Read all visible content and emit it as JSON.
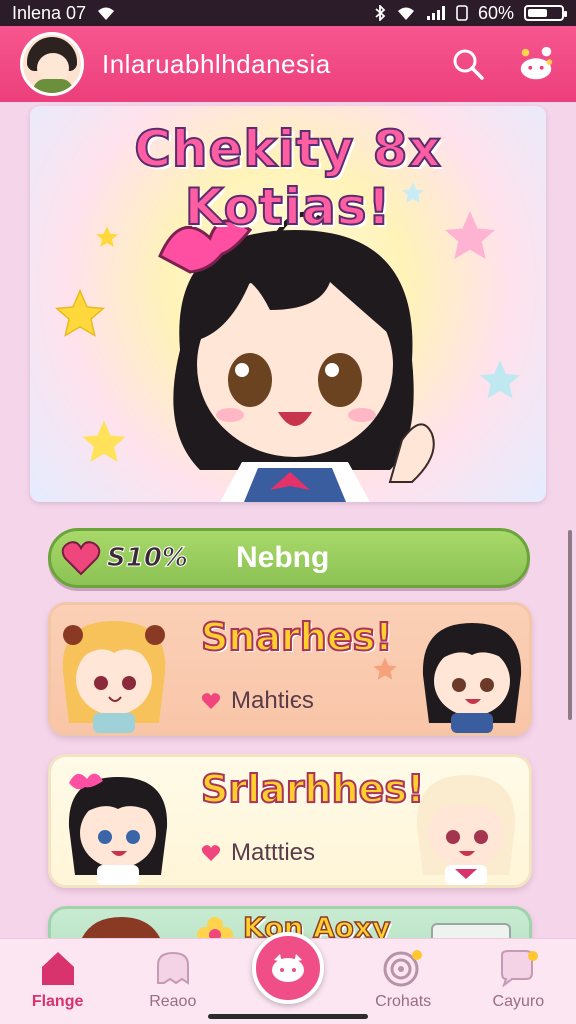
{
  "status_bar": {
    "carrier": "Inlena 07",
    "battery_text": "60%",
    "battery_level": 0.6
  },
  "header": {
    "title": "Inlaruabhlhdanesia",
    "icons": [
      "avatar",
      "search-icon",
      "game-icon"
    ]
  },
  "banner": {
    "title": "Chekity 8x Kotias!"
  },
  "progress_pill": {
    "percent_text": "S10%",
    "label": "Nebng"
  },
  "cards": [
    {
      "title": "Snarhes!",
      "subtitle": "Mahtiєs"
    },
    {
      "title": "Srlarhhes!",
      "subtitle": "Mattties"
    },
    {
      "title": "Kon Aoxy",
      "subtitle": ""
    }
  ],
  "bottom_nav": [
    {
      "label": "Flange",
      "icon": "home-icon",
      "active": true
    },
    {
      "label": "Reaoo",
      "icon": "ghost-icon",
      "active": false
    },
    {
      "label": "",
      "icon": "face-icon",
      "active": false
    },
    {
      "label": "Crohats",
      "icon": "target-icon",
      "active": false
    },
    {
      "label": "Cayuro",
      "icon": "chat-icon",
      "active": false
    }
  ],
  "colors": {
    "header": "#ec3f7c",
    "pill": "#8cc354",
    "background": "#f5d5ea",
    "accent": "#d8336d"
  }
}
